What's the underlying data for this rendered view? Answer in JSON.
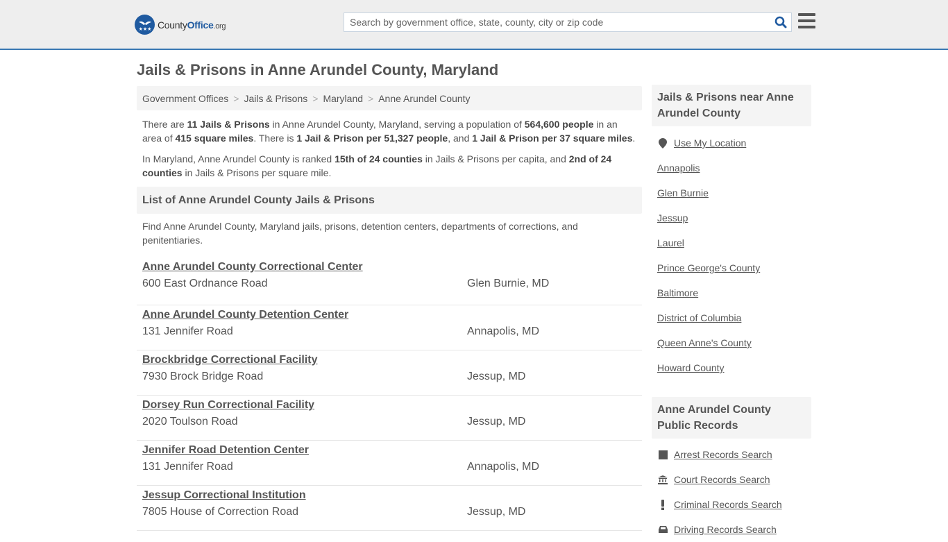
{
  "header": {
    "logo": {
      "brand_plain": "County",
      "brand_bold": "Office",
      "brand_tld": ".org"
    },
    "search": {
      "placeholder": "Search by government office, state, county, city or zip code",
      "value": ""
    }
  },
  "page_title": "Jails & Prisons in Anne Arundel County, Maryland",
  "breadcrumb": [
    "Government Offices",
    "Jails & Prisons",
    "Maryland",
    "Anne Arundel County"
  ],
  "intro": {
    "p1": [
      {
        "t": "There are ",
        "b": false
      },
      {
        "t": "11 Jails & Prisons",
        "b": true
      },
      {
        "t": " in Anne Arundel County, Maryland, serving a population of ",
        "b": false
      },
      {
        "t": "564,600 people",
        "b": true
      },
      {
        "t": " in an area of ",
        "b": false
      },
      {
        "t": "415 square miles",
        "b": true
      },
      {
        "t": ". There is ",
        "b": false
      },
      {
        "t": "1 Jail & Prison per 51,327 people",
        "b": true
      },
      {
        "t": ", and ",
        "b": false
      },
      {
        "t": "1 Jail & Prison per 37 square miles",
        "b": true
      },
      {
        "t": ".",
        "b": false
      }
    ],
    "p2": [
      {
        "t": "In Maryland, Anne Arundel County is ranked ",
        "b": false
      },
      {
        "t": "15th of 24 counties",
        "b": true
      },
      {
        "t": " in Jails & Prisons per capita, and ",
        "b": false
      },
      {
        "t": "2nd of 24 counties",
        "b": true
      },
      {
        "t": " in Jails & Prisons per square mile.",
        "b": false
      }
    ]
  },
  "list_section": {
    "heading": "List of Anne Arundel County Jails & Prisons",
    "description": "Find Anne Arundel County, Maryland jails, prisons, detention centers, departments of corrections, and penitentiaries.",
    "items": [
      {
        "name": "Anne Arundel County Correctional Center",
        "address": "600 East Ordnance Road",
        "city": "Glen Burnie, MD"
      },
      {
        "name": "Anne Arundel County Detention Center",
        "address": "131 Jennifer Road",
        "city": "Annapolis, MD"
      },
      {
        "name": "Brockbridge Correctional Facility",
        "address": "7930 Brock Bridge Road",
        "city": "Jessup, MD"
      },
      {
        "name": "Dorsey Run Correctional Facility",
        "address": "2020 Toulson Road",
        "city": "Jessup, MD"
      },
      {
        "name": "Jennifer Road Detention Center",
        "address": "131 Jennifer Road",
        "city": "Annapolis, MD"
      },
      {
        "name": "Jessup Correctional Institution",
        "address": "7805 House of Correction Road",
        "city": "Jessup, MD"
      }
    ]
  },
  "sidebar": {
    "nearby": {
      "heading": "Jails & Prisons near Anne Arundel County",
      "use_location": "Use My Location",
      "links": [
        "Annapolis",
        "Glen Burnie",
        "Jessup",
        "Laurel",
        "Prince George's County",
        "Baltimore",
        "District of Columbia",
        "Queen Anne's County",
        "Howard County"
      ]
    },
    "records": {
      "heading": "Anne Arundel County Public Records",
      "links": [
        {
          "label": "Arrest Records Search",
          "icon": "square-icon"
        },
        {
          "label": "Court Records Search",
          "icon": "courthouse-icon"
        },
        {
          "label": "Criminal Records Search",
          "icon": "exclamation-icon"
        },
        {
          "label": "Driving Records Search",
          "icon": "car-icon"
        }
      ]
    }
  }
}
